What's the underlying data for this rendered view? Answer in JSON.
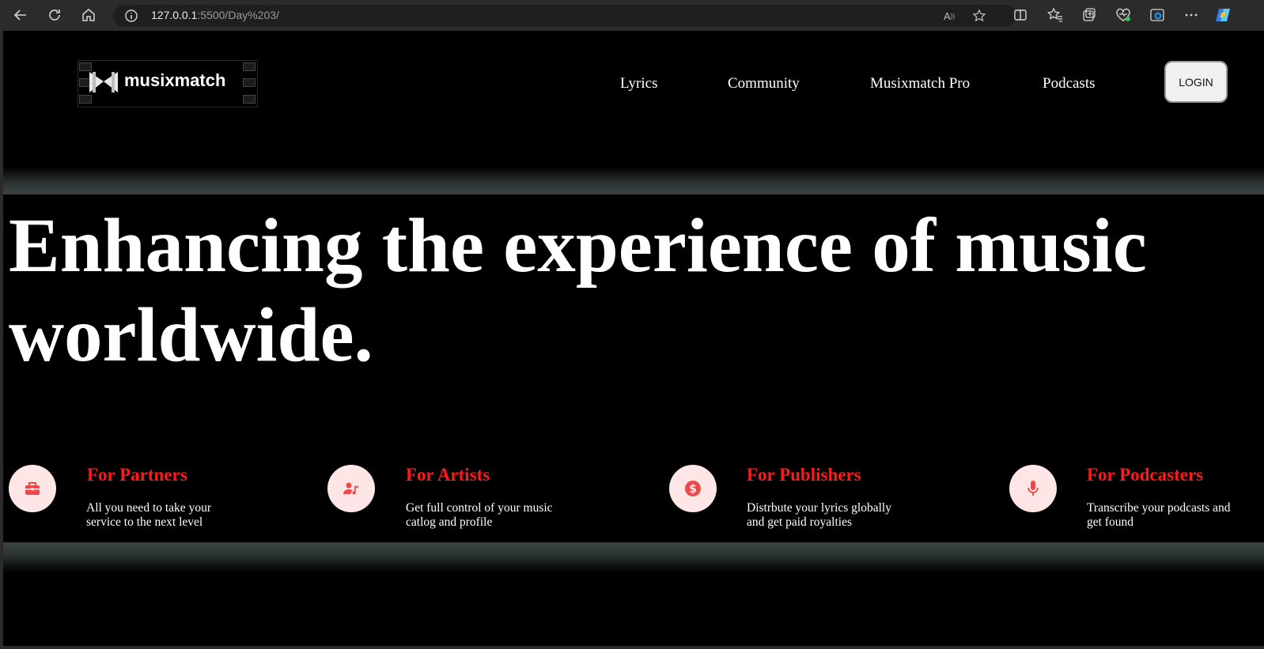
{
  "browser": {
    "url_host": "127.0.0.1",
    "url_rest": ":5500/Day%203/"
  },
  "site": {
    "brand": "musixmatch",
    "nav": [
      "Lyrics",
      "Community",
      "Musixmatch Pro",
      "Podcasts"
    ],
    "login_label": "LOGIN"
  },
  "hero": {
    "headline": "Enhancing the experience of music worldwide."
  },
  "features": [
    {
      "icon": "briefcase-icon",
      "title": "For Partners",
      "desc": "All you need to take your service to the next level"
    },
    {
      "icon": "artist-music-icon",
      "title": "For Artists",
      "desc": "Get full control of your music catlog and profile"
    },
    {
      "icon": "dollar-icon",
      "title": "For Publishers",
      "desc": "Distrbute your lyrics globally and get paid royalties"
    },
    {
      "icon": "microphone-icon",
      "title": "For Podcasters",
      "desc": "Transcribe your podcasts and get found"
    }
  ],
  "colors": {
    "accent": "#ff1a1a",
    "icon_bg": "#ffe6e6",
    "page_bg": "#000000",
    "chrome_bg": "#2b2b2b"
  }
}
